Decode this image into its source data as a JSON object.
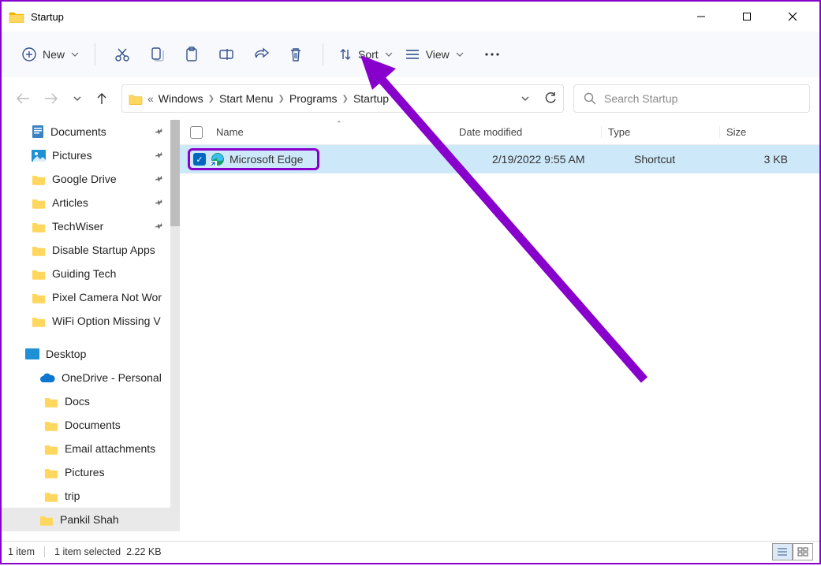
{
  "window": {
    "title": "Startup"
  },
  "toolbar": {
    "new_label": "New",
    "sort_label": "Sort",
    "view_label": "View"
  },
  "breadcrumbs": {
    "items": [
      "Windows",
      "Start Menu",
      "Programs",
      "Startup"
    ],
    "prefix": "«"
  },
  "search": {
    "placeholder": "Search Startup"
  },
  "columns": {
    "name": "Name",
    "date": "Date modified",
    "type": "Type",
    "size": "Size"
  },
  "sidebar": {
    "quick": [
      {
        "label": "Documents",
        "pinned": true,
        "icon": "doc"
      },
      {
        "label": "Pictures",
        "pinned": true,
        "icon": "pic"
      },
      {
        "label": "Google Drive",
        "pinned": true,
        "icon": "folder"
      },
      {
        "label": "Articles",
        "pinned": true,
        "icon": "folder"
      },
      {
        "label": "TechWiser",
        "pinned": true,
        "icon": "folder"
      },
      {
        "label": "Disable Startup Apps",
        "pinned": false,
        "icon": "folder"
      },
      {
        "label": "Guiding Tech",
        "pinned": false,
        "icon": "folder"
      },
      {
        "label": "Pixel Camera Not Wor",
        "pinned": false,
        "icon": "folder"
      },
      {
        "label": "WiFi Option Missing V",
        "pinned": false,
        "icon": "folder"
      }
    ],
    "desktop": "Desktop",
    "onedrive": "OneDrive - Personal",
    "onedrive_children": [
      "Docs",
      "Documents",
      "Email attachments",
      "Pictures",
      "trip"
    ],
    "selected": "Pankil Shah"
  },
  "files": [
    {
      "name": "Microsoft Edge",
      "date": "2/19/2022 9:55 AM",
      "type": "Shortcut",
      "size": "3 KB",
      "checked": true
    }
  ],
  "status": {
    "count": "1 item",
    "selected": "1 item selected",
    "size": "2.22 KB"
  }
}
